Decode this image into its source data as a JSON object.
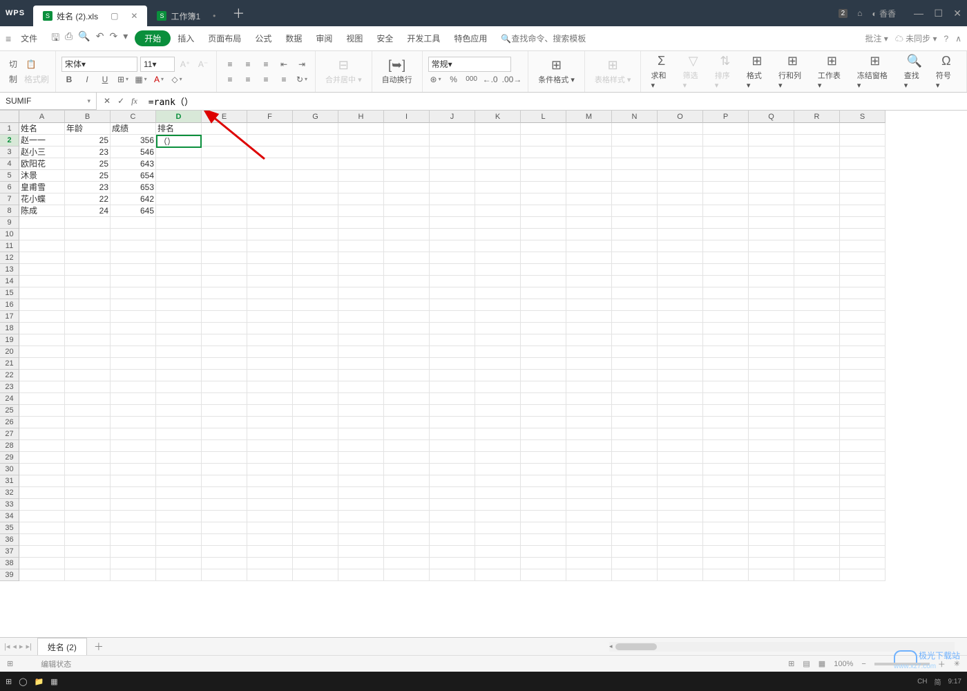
{
  "app": {
    "logo": "WPS"
  },
  "tabs": [
    {
      "label": "姓名 (2).xls",
      "active": true,
      "indicator": "▢"
    },
    {
      "label": "工作簿1",
      "active": false,
      "indicator": "•"
    }
  ],
  "titlebar_right": {
    "badge": "2",
    "user": "香香"
  },
  "menubar": {
    "file": "文件",
    "items": [
      "开始",
      "插入",
      "页面布局",
      "公式",
      "数据",
      "审阅",
      "视图",
      "安全",
      "开发工具",
      "特色应用"
    ],
    "active": 0,
    "search_placeholder": "查找命令、搜索模板",
    "right": {
      "batch": "批注 ▾",
      "sync": "未同步 ▾"
    }
  },
  "ribbon": {
    "clip": {
      "cut": "切",
      "copy": "制",
      "brush": "格式刷"
    },
    "font": {
      "name": "宋体",
      "size": "11",
      "bold": "B",
      "italic": "I",
      "underline": "U"
    },
    "align": {
      "merge": "合并居中 ▾",
      "wrap": "自动换行"
    },
    "number": {
      "format": "常规"
    },
    "styles": {
      "cond": "条件格式 ▾",
      "cell": "表格样式 ▾"
    },
    "cells": {
      "sum": "求和 ▾",
      "filter": "筛选 ▾",
      "sort": "排序 ▾",
      "format": "格式 ▾",
      "rowcol": "行和列 ▾",
      "sheet": "工作表 ▾",
      "freeze": "冻结窗格 ▾",
      "find": "查找 ▾",
      "symbol": "符号 ▾"
    }
  },
  "formula_bar": {
    "namebox": "SUMIF",
    "formula": "=rank（）",
    "cancel": "✕",
    "confirm": "✓",
    "fx": "fx"
  },
  "columns": [
    "A",
    "B",
    "C",
    "D",
    "E",
    "F",
    "G",
    "H",
    "I",
    "J",
    "K",
    "L",
    "M",
    "N",
    "O",
    "P",
    "Q",
    "R",
    "S"
  ],
  "active_col": 3,
  "active_row": 1,
  "headers": [
    "姓名",
    "年龄",
    "成绩",
    "排名"
  ],
  "data_rows": [
    {
      "name": "赵一一",
      "age": 25,
      "score": 356,
      "rank": "（）"
    },
    {
      "name": "赵小三",
      "age": 23,
      "score": 546,
      "rank": ""
    },
    {
      "name": "欧阳花",
      "age": 25,
      "score": 643,
      "rank": ""
    },
    {
      "name": "沐景",
      "age": 25,
      "score": 654,
      "rank": ""
    },
    {
      "name": "皇甫雪",
      "age": 23,
      "score": 653,
      "rank": ""
    },
    {
      "name": "花小蝶",
      "age": 22,
      "score": 642,
      "rank": ""
    },
    {
      "name": "陈成",
      "age": 24,
      "score": 645,
      "rank": ""
    }
  ],
  "total_rows": 39,
  "sheet_tabs": {
    "active": "姓名 (2)"
  },
  "statusbar": {
    "mode": "编辑状态",
    "zoom": "100%"
  },
  "taskbar": {
    "ime": "CH",
    "ime2": "简",
    "time": "9:17"
  },
  "watermark": {
    "text": "极光下载站",
    "site": "www.xz7.com"
  }
}
